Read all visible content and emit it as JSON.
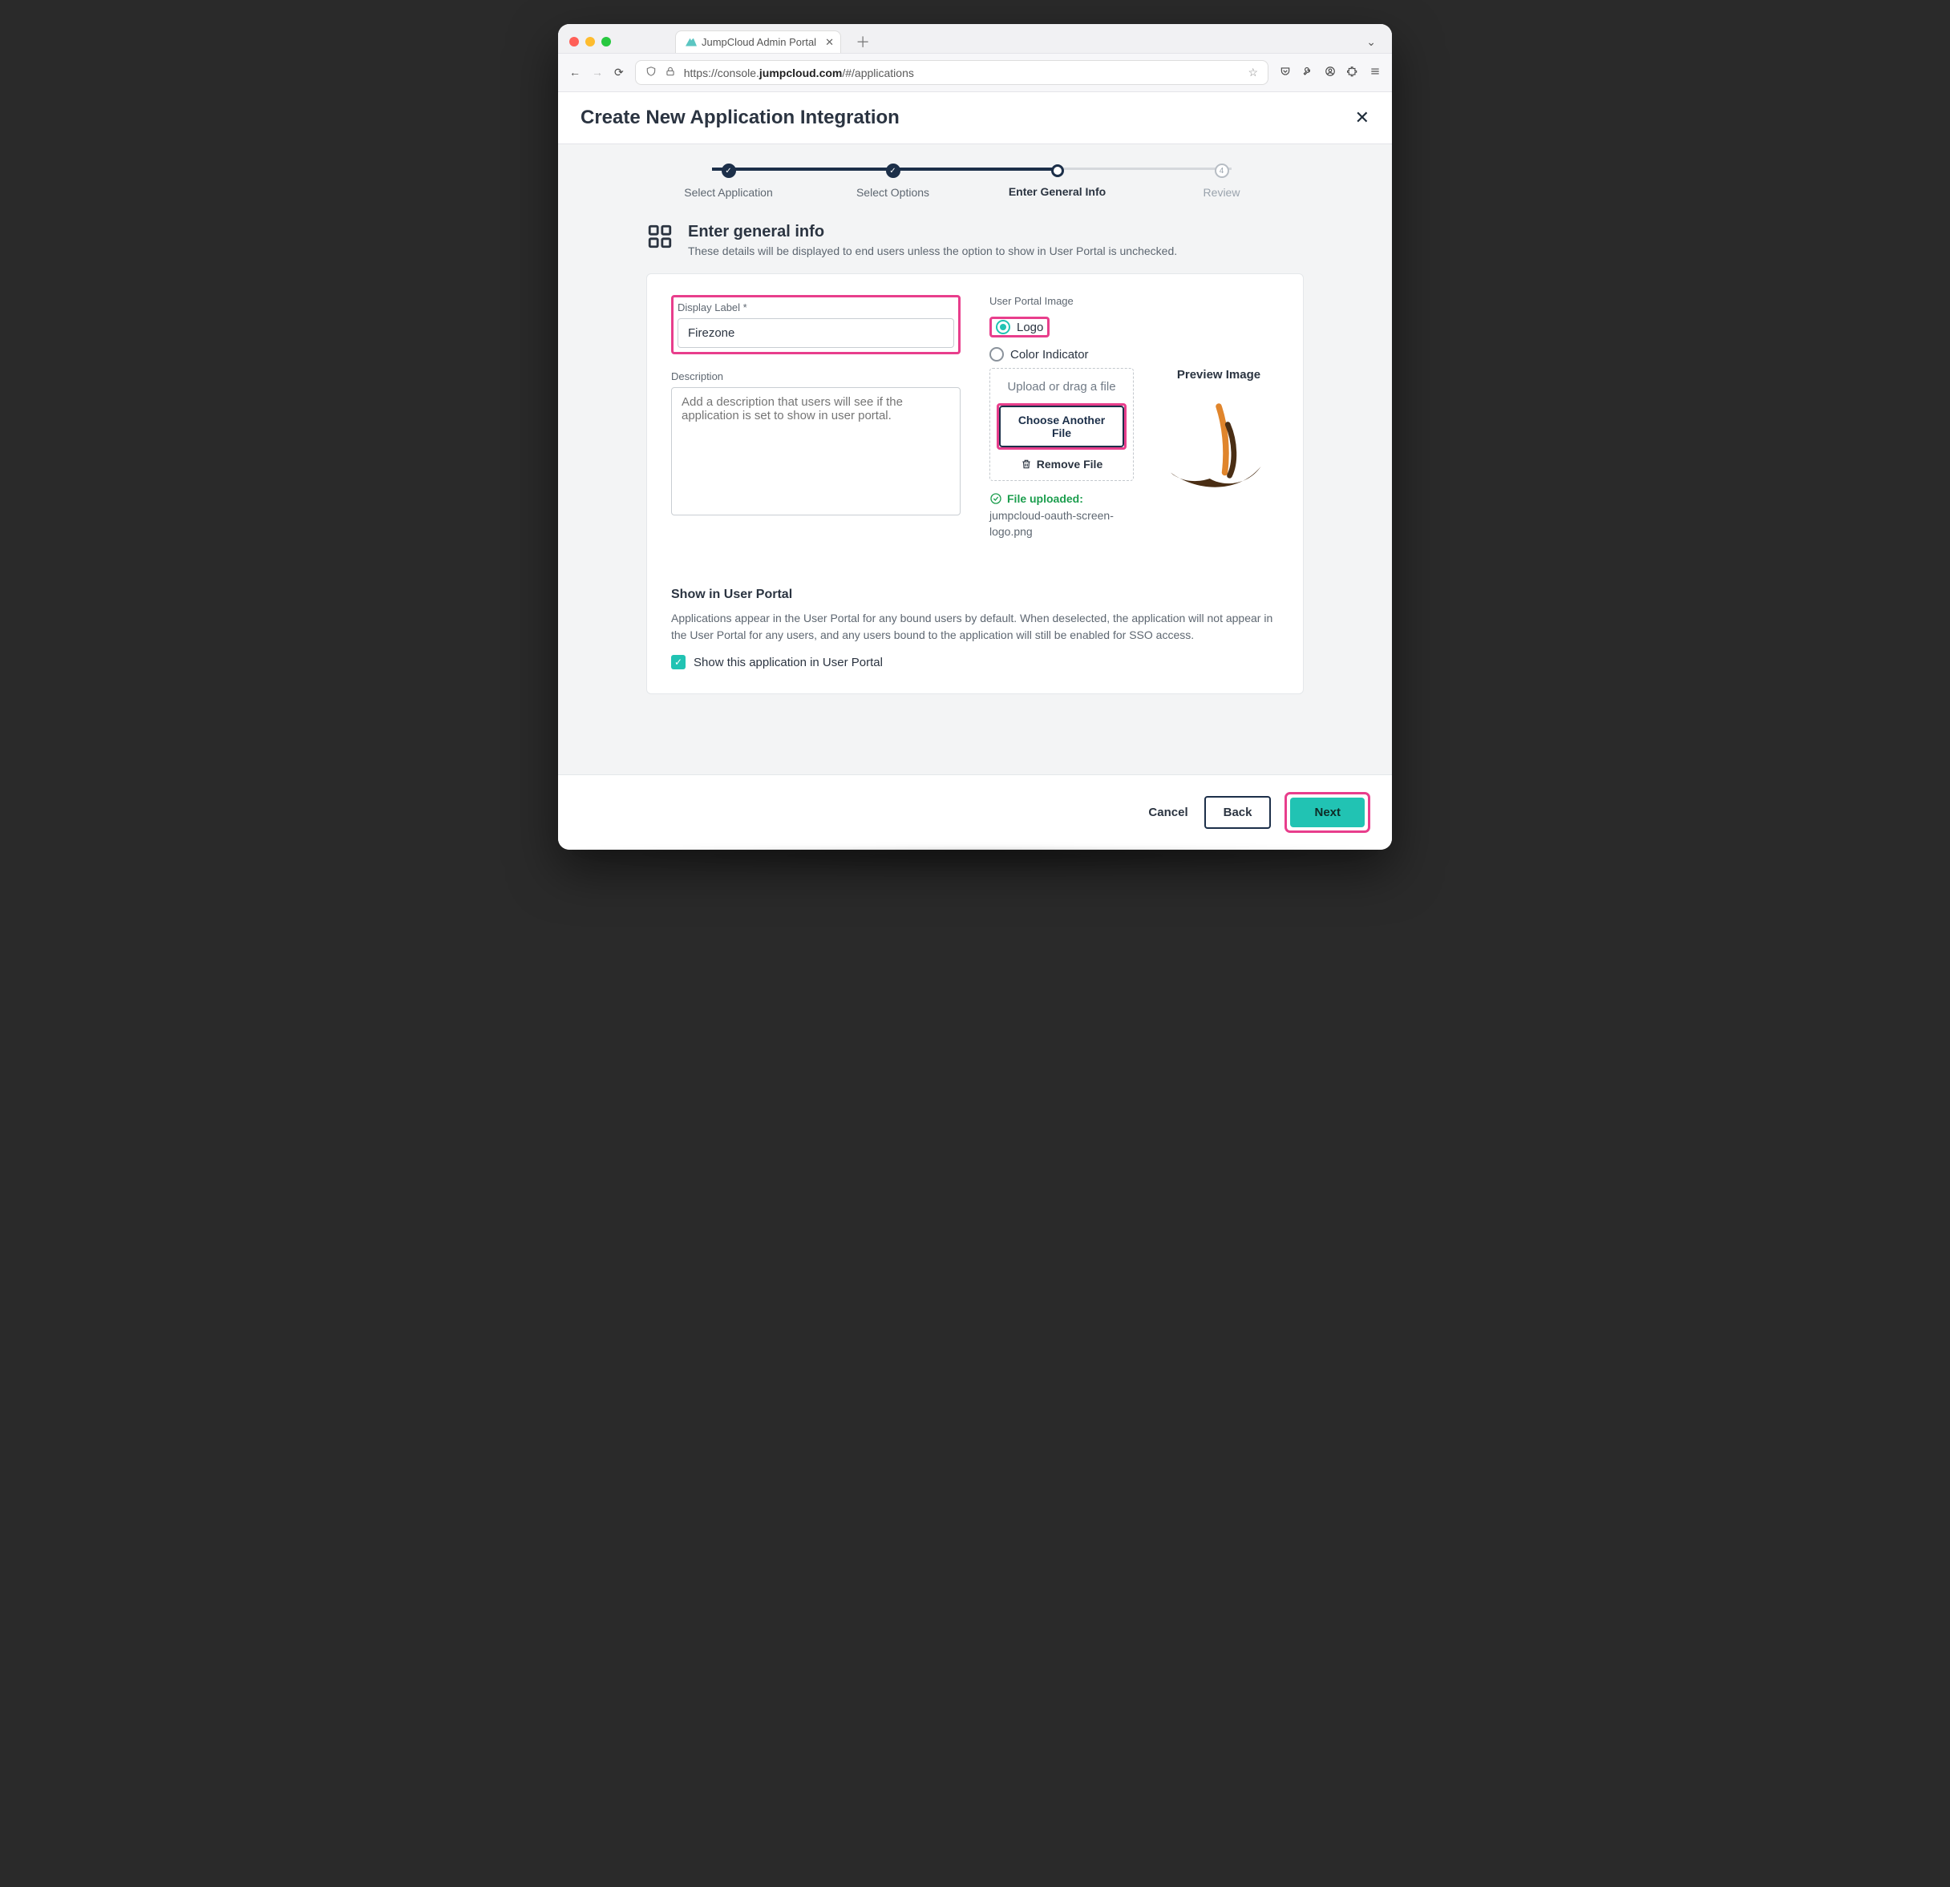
{
  "browser": {
    "tab_title": "JumpCloud Admin Portal",
    "url_display": "https://console.jumpcloud.com/#/applications",
    "url_host": "jumpcloud.com"
  },
  "header": {
    "title": "Create New Application Integration"
  },
  "stepper": {
    "steps": [
      {
        "label": "Select Application"
      },
      {
        "label": "Select Options"
      },
      {
        "label": "Enter General Info"
      },
      {
        "label": "Review"
      }
    ]
  },
  "lead": {
    "title": "Enter general info",
    "subtitle": "These details will be displayed to end users unless the option to show in User Portal is unchecked."
  },
  "form": {
    "display_label_label": "Display Label *",
    "display_label_value": "Firezone",
    "description_label": "Description",
    "description_placeholder": "Add a description that users will see if the application is set to show in user portal.",
    "user_portal_image_label": "User Portal Image",
    "radio_logo": "Logo",
    "radio_color": "Color Indicator",
    "upload_hint": "Upload or drag a file",
    "choose_file_btn": "Choose Another File",
    "remove_file": "Remove File",
    "file_uploaded_label": "File uploaded:",
    "file_name": "jumpcloud-oauth-screen-logo.png",
    "preview_label": "Preview Image"
  },
  "portal": {
    "heading": "Show in User Portal",
    "desc": "Applications appear in the User Portal for any bound users by default. When deselected, the application will not appear in the User Portal for any users, and any users bound to the application will still be enabled for SSO access.",
    "checkbox_label": "Show this application in User Portal"
  },
  "footer": {
    "cancel": "Cancel",
    "back": "Back",
    "next": "Next"
  }
}
